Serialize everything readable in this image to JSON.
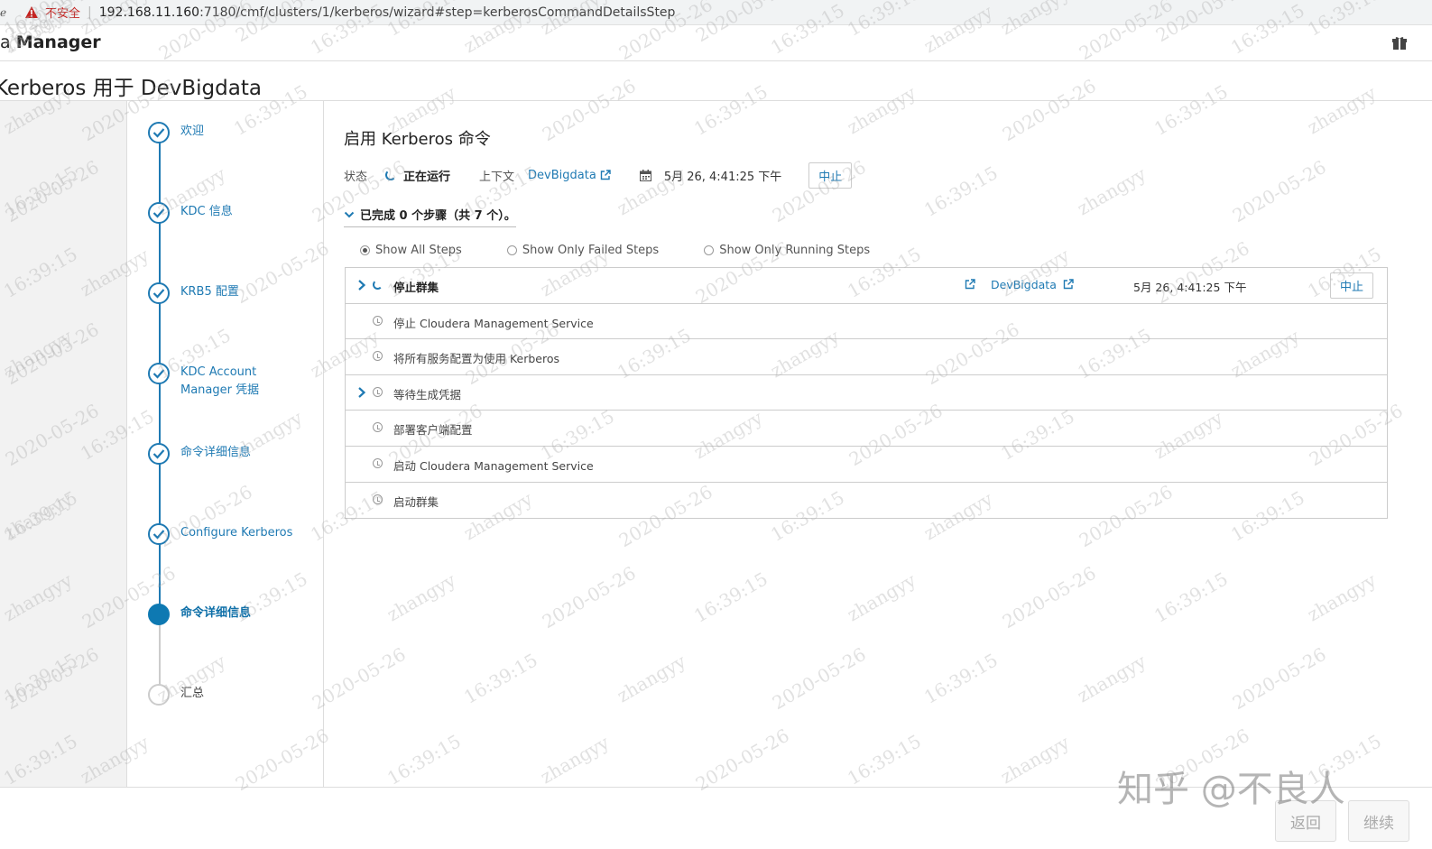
{
  "browser": {
    "insecure_label": "不安全",
    "url_host": "192.168.11.160",
    "url_rest": ":7180/cmf/clusters/1/kerberos/wizard#step=kerberosCommandDetailsStep"
  },
  "header": {
    "brand_prefix": "a",
    "brand_bold": "Manager"
  },
  "page": {
    "title": "Kerberos 用于 DevBigdata"
  },
  "wizard": {
    "steps": [
      {
        "label": "欢迎",
        "state": "done"
      },
      {
        "label": "KDC 信息",
        "state": "done"
      },
      {
        "label": "KRB5 配置",
        "state": "done"
      },
      {
        "label": "KDC Account Manager 凭据",
        "state": "done"
      },
      {
        "label": "命令详细信息",
        "state": "done"
      },
      {
        "label": "Configure Kerberos",
        "state": "done"
      },
      {
        "label": "命令详细信息",
        "state": "active"
      },
      {
        "label": "汇总",
        "state": "pending"
      }
    ]
  },
  "command": {
    "title": "启用 Kerberos 命令",
    "status_label": "状态",
    "status_value": "正在运行",
    "context_label": "上下文",
    "context_link": "DevBigdata",
    "time": "5月 26, 4:41:25 下午",
    "abort_label": "中止",
    "summary": "已完成 0 个步骤（共 7 个）。"
  },
  "filters": [
    {
      "label": "Show All Steps",
      "selected": true
    },
    {
      "label": "Show Only Failed Steps",
      "selected": false
    },
    {
      "label": "Show Only Running Steps",
      "selected": false
    }
  ],
  "steps": [
    {
      "name": "停止群集",
      "expandable": true,
      "running": true,
      "context": "DevBigdata",
      "time": "5月 26, 4:41:25 下午",
      "abort": "中止"
    },
    {
      "name": "停止 Cloudera Management Service",
      "expandable": false
    },
    {
      "name": "将所有服务配置为使用 Kerberos",
      "expandable": false
    },
    {
      "name": "等待生成凭据",
      "expandable": true
    },
    {
      "name": "部署客户端配置",
      "expandable": false
    },
    {
      "name": "启动 Cloudera Management Service",
      "expandable": false
    },
    {
      "name": "启动群集",
      "expandable": false
    }
  ],
  "footer": {
    "back_label": "返回",
    "continue_label": "继续"
  },
  "watermark": {
    "user": "zhangyy",
    "date": "2020-05-26",
    "time": "16:39:15",
    "brand": "知乎 @不良人"
  },
  "colors": {
    "accent": "#1f7ab3",
    "active_step": "#0e79b2",
    "warning": "#c5221f"
  }
}
